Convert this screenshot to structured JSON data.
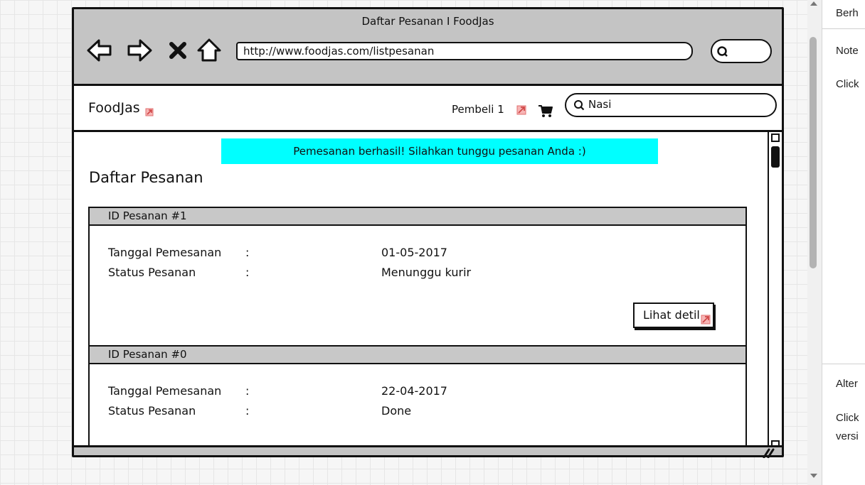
{
  "browser": {
    "window_title": "Daftar Pesanan I FoodJas",
    "url": "http://www.foodjas.com/listpesanan",
    "nav_icons": [
      "back-arrow-icon",
      "forward-arrow-icon",
      "close-icon",
      "home-icon"
    ]
  },
  "header": {
    "logo": "FoodJas",
    "user_label": "Pembeli 1",
    "search_value": "Nasi"
  },
  "content": {
    "success_message": "Pemesanan berhasil! Silahkan tunggu pesanan Anda :)",
    "page_title": "Daftar Pesanan",
    "orders": [
      {
        "header": "ID Pesanan #1",
        "date_label": "Tanggal Pemesanan",
        "date_value": "01-05-2017",
        "status_label": "Status Pesanan",
        "status_value": "Menunggu kurir",
        "colon": ":",
        "detail_button": "Lihat detil"
      },
      {
        "header": "ID Pesanan #0",
        "date_label": "Tanggal Pemesanan",
        "date_value": "22-04-2017",
        "status_label": "Status Pesanan",
        "status_value": "Done",
        "colon": ":"
      }
    ]
  },
  "side_panel": {
    "lines": [
      "Berh",
      "Note",
      "Click",
      "Alter",
      "Click",
      "versi"
    ]
  },
  "colors": {
    "success_bg": "#00ffff",
    "chrome_gray": "#c4c4c4",
    "link_icon": "#f08080"
  }
}
